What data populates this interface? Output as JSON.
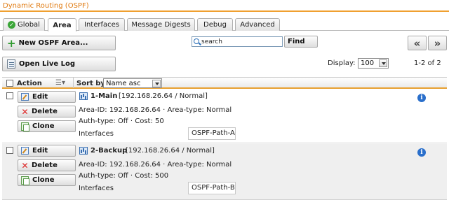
{
  "window": {
    "title": "Dynamic Routing (OSPF)"
  },
  "tabs": [
    {
      "label": "Global",
      "icon": "check-icon"
    },
    {
      "label": "Area",
      "active": true
    },
    {
      "label": "Interfaces"
    },
    {
      "label": "Message Digests"
    },
    {
      "label": "Debug"
    },
    {
      "label": "Advanced"
    }
  ],
  "toolbar": {
    "new_area_label": "New OSPF Area...",
    "open_log_label": "Open Live Log",
    "search_value": "search",
    "find_label": "Find",
    "prev_label": "«",
    "next_label": "»",
    "display_label": "Display:",
    "display_value": "100",
    "range_text": "1-2 of 2"
  },
  "grid": {
    "action_header": "Action",
    "sort_label": "Sort by:",
    "sort_value": "Name asc"
  },
  "row_buttons": {
    "edit": "Edit",
    "delete": "Delete",
    "clone": "Clone"
  },
  "areas": [
    {
      "name": "1-Main",
      "summary": "[192.168.26.64 / Normal]",
      "line1": "Area-ID: 192.168.26.64 · Area-type: Normal",
      "line2": "Auth-type: Off · Cost: 50",
      "interfaces_label": "Interfaces",
      "interface": "OSPF-Path-A"
    },
    {
      "name": "2-Backup",
      "summary": "[192.168.26.64 / Normal]",
      "line1": "Area-ID: 192.168.26.64 · Area-type: Normal",
      "line2": "Auth-type: Off · Cost: 500",
      "interfaces_label": "Interfaces",
      "interface": "OSPF-Path-B"
    }
  ],
  "colors": {
    "accent": "#f0a030",
    "title": "#e07a10",
    "info": "#2a6fcb"
  }
}
